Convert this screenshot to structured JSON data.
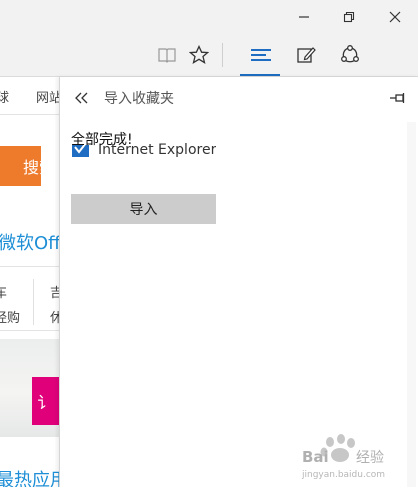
{
  "window": {
    "minimize": "—",
    "maximize": "❐",
    "close": "✕"
  },
  "toolbar": {
    "icons": [
      "reading-view-icon",
      "favorite-star-icon",
      "hub-icon",
      "web-note-icon",
      "share-icon"
    ]
  },
  "page": {
    "nav_item_1": "球",
    "nav_item_2": "网站",
    "search_button": "搜索",
    "heading": "微软Offi",
    "col_1_top": "车",
    "col_1_bottom": "经购",
    "col_2_top": "吉",
    "col_2_bottom": "休",
    "banner_text": "讠",
    "footer_heading": "最热应用"
  },
  "panel": {
    "title": "导入收藏夹",
    "completion_message": "全部完成!",
    "browser_option": "Internet Explorer",
    "import_button": "导入"
  },
  "watermark": {
    "brand": "Baidu 经验",
    "url": "jingyan.baidu.com"
  },
  "colors": {
    "accent_blue": "#1f6dc2",
    "search_orange": "#ee7a2c",
    "banner_magenta": "#e0007a",
    "heading_blue": "#1e8fd6"
  }
}
